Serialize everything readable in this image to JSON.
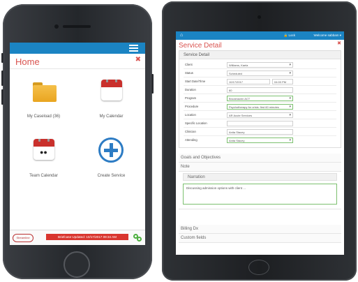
{
  "phone": {
    "home_title": "Home",
    "close_glyph": "✖",
    "tiles": [
      {
        "label": "My Caseload (36)",
        "icon": "folder-icon"
      },
      {
        "label": "My Calendar",
        "icon": "calendar-icon"
      },
      {
        "label": "Team Calendar",
        "icon": "team-calendar-icon"
      },
      {
        "label": "Create Service",
        "icon": "plus-circle-icon"
      }
    ],
    "footer": {
      "logo_text": "Streamline",
      "briefcase_text": "Briefcase Updated: 10/17/2017 09:34 AM"
    },
    "colors": {
      "topbar": "#1b84c3",
      "accent": "#d9534f",
      "plus": "#2d7cc4",
      "link": "#4caf3e"
    }
  },
  "tablet": {
    "topbar": {
      "home_glyph": "⌂",
      "lock_label": "🔒 Lock",
      "welcome_label": "Welcome sabbam ▾"
    },
    "page_title": "Service Detail",
    "close_glyph": "✖",
    "panel_title": "Service Detail",
    "fields": [
      {
        "key": "Client",
        "value": "Williams, Kaela",
        "select": true,
        "green": false
      },
      {
        "key": "Status",
        "value": "Scheduled",
        "select": true,
        "green": false
      },
      {
        "key": "Start Date/Time",
        "value": "10/17/2017",
        "value2": "04:00 PM",
        "select": false,
        "green": false
      },
      {
        "key": "Duration",
        "value": "60",
        "select": false,
        "green": false
      },
      {
        "key": "Program",
        "value": "Brookhaven ACT",
        "select": true,
        "green": true
      },
      {
        "key": "Procedure",
        "value": "Psychotherapy for crisis: first 60 minutes",
        "select": true,
        "green": true
      },
      {
        "key": "Location",
        "value": "AR Acute Services",
        "select": true,
        "green": false
      },
      {
        "key": "Specific Location",
        "value": "",
        "select": false,
        "green": false
      },
      {
        "key": "Clinician",
        "value": "Anita Stacey",
        "select": false,
        "green": false
      },
      {
        "key": "Attending",
        "value": "Anita Stacey",
        "select": true,
        "green": true
      }
    ],
    "sections": {
      "goals": "Goals and Objectives",
      "note": "Note",
      "narration": "Narration",
      "narration_text": "Discussing admission options with client ...",
      "billing": "Billing Dx",
      "custom": "Custom fields"
    }
  }
}
